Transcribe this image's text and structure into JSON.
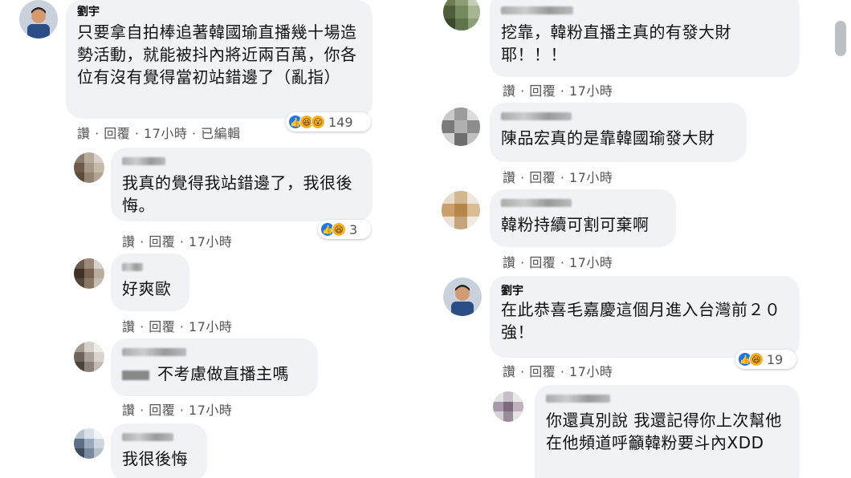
{
  "left": {
    "c1": {
      "name": "劉宇",
      "text": "只要拿自拍棒追著韓國瑜直播幾十場造勢活動，就能被抖內將近兩百萬，你各位有沒有覺得當初站錯邊了（亂指）",
      "actions": "讚 · 回覆 · 17小時 · 已編輯",
      "reactions": [
        "like",
        "haha",
        "wow"
      ],
      "count": "149"
    },
    "c2": {
      "text": "我真的覺得我站錯邊了，我很後悔。",
      "actions": "讚 · 回覆 · 17小時",
      "reactions": [
        "like",
        "haha"
      ],
      "count": "3"
    },
    "c3": {
      "text": "好爽歐",
      "actions": "讚 · 回覆 · 17小時"
    },
    "c4": {
      "text": "不考慮做直播主嗎",
      "actions": "讚 · 回覆 · 17小時"
    },
    "c5": {
      "text": "我很後悔"
    }
  },
  "right": {
    "c1": {
      "text": "挖靠，韓粉直播主真的有發大財耶！！！",
      "actions": "讚 · 回覆 · 17小時"
    },
    "c2": {
      "text": "陳品宏真的是靠韓國瑜發大財",
      "actions": "讚 · 回覆 · 17小時"
    },
    "c3": {
      "text": "韓粉持續可割可棄啊",
      "actions": "讚 · 回覆 · 17小時"
    },
    "c4": {
      "name": "劉宇",
      "text": "在此恭喜毛嘉慶這個月進入台灣前２０強！",
      "actions": "讚 · 回覆 · 17小時",
      "reactions": [
        "like",
        "haha"
      ],
      "count": "19"
    },
    "c5": {
      "text": "你還真別說 我還記得你上次幫他在他頻道呼籲韓粉要斗內XDD"
    }
  },
  "colors": {
    "bubble": "#f0f2f5",
    "like": "#1877f2",
    "haha": "#f7b125"
  }
}
